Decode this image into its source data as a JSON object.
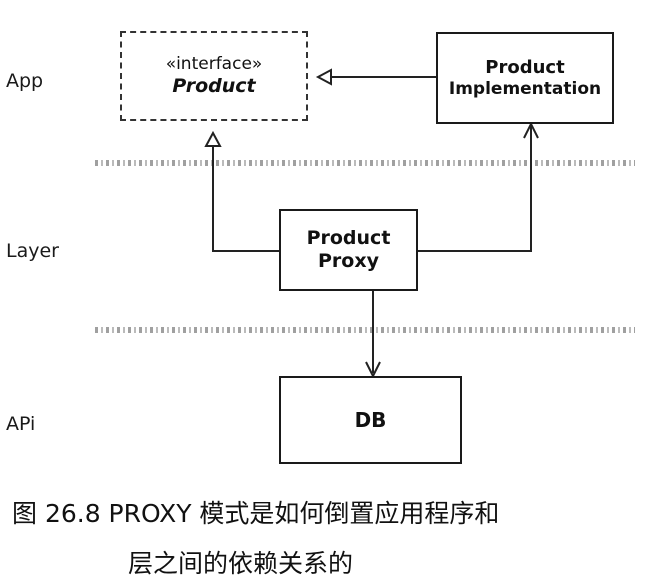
{
  "layers": {
    "app": "App",
    "layer": "Layer",
    "api": "APi"
  },
  "boxes": {
    "product": {
      "stereotype": "«interface»",
      "name": "Product"
    },
    "product_impl": {
      "line1": "Product",
      "line2": "Implementation"
    },
    "proxy": {
      "line1": "Product",
      "line2": "Proxy"
    },
    "db": {
      "name": "DB"
    }
  },
  "caption": {
    "line1": "图 26.8   PROXY 模式是如何倒置应用程序和",
    "line2": "层之间的依赖关系的"
  }
}
